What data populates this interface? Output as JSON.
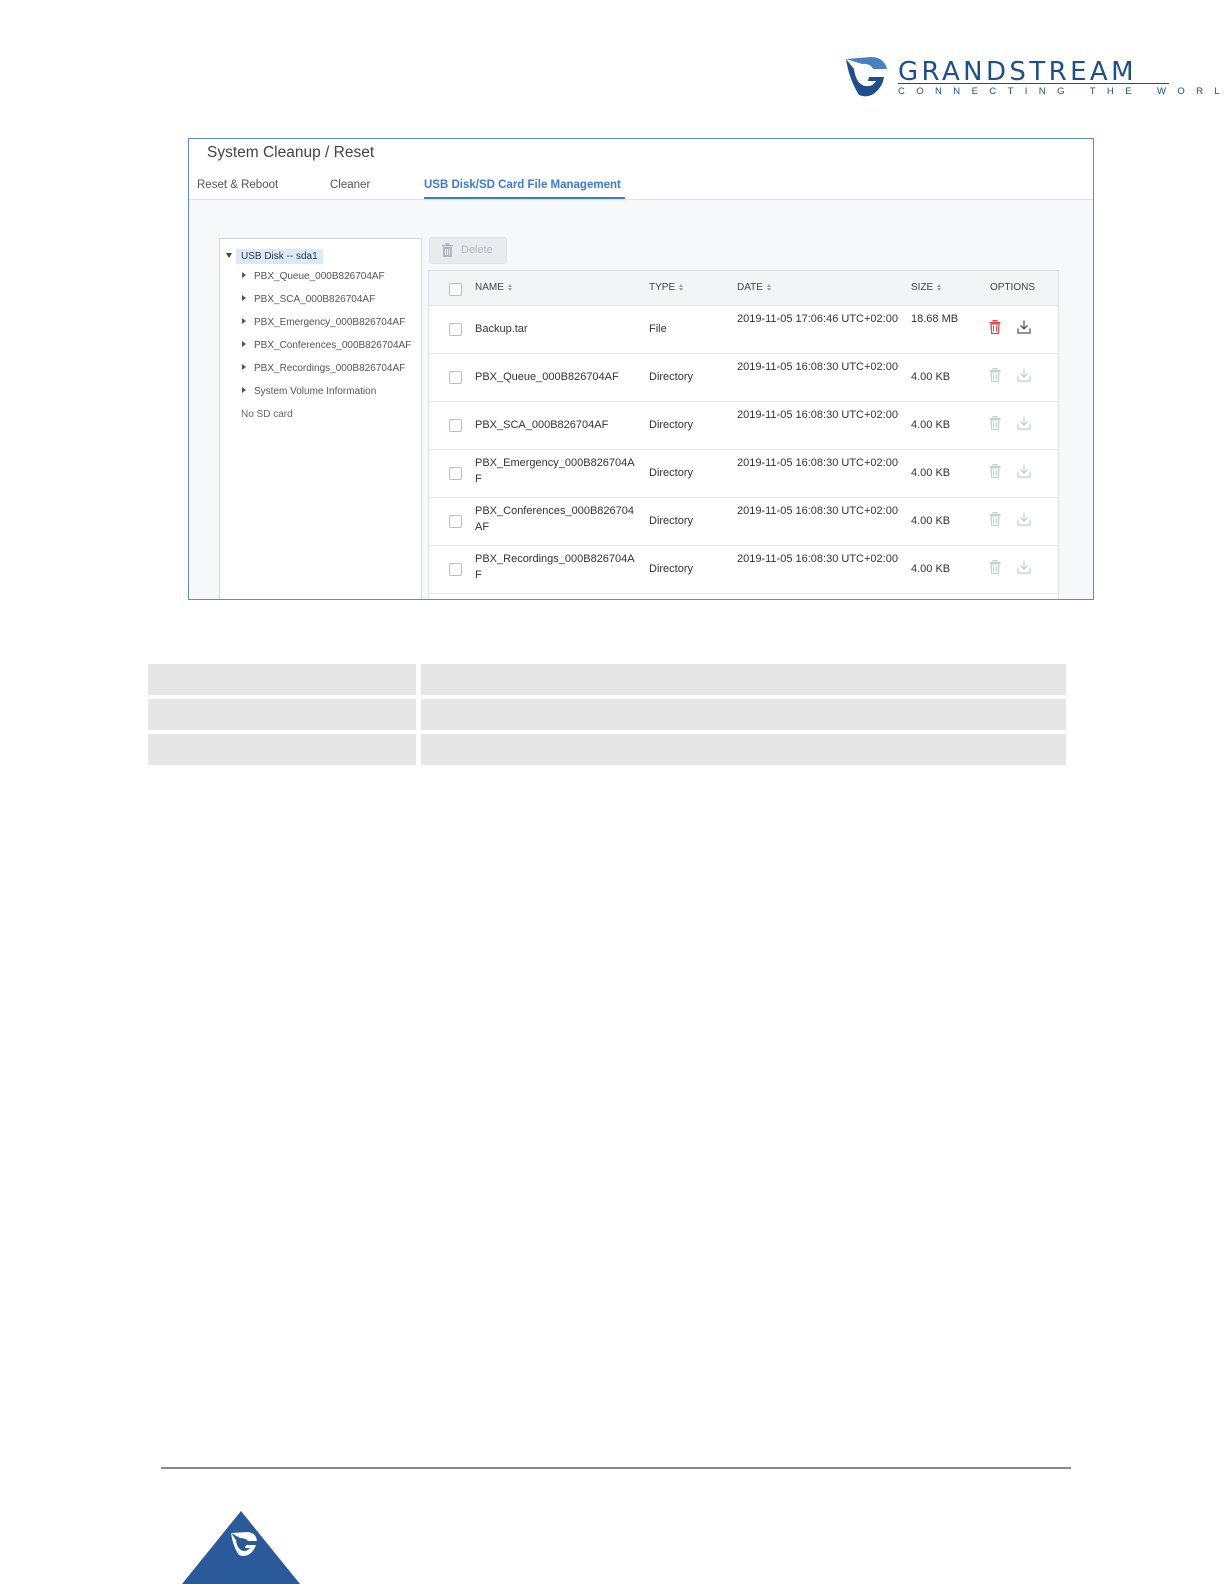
{
  "brand": {
    "name": "GRANDSTREAM",
    "tagline": "CONNECTING THE WORLD",
    "colors": {
      "primary": "#1f4e8c",
      "accent": "#3b7ad8",
      "delete_red": "#e24a4a"
    }
  },
  "panel": {
    "title": "System Cleanup / Reset",
    "tabs": [
      {
        "label": "Reset & Reboot",
        "active": false
      },
      {
        "label": "Cleaner",
        "active": false
      },
      {
        "label": "USB Disk/SD Card File Management",
        "active": true
      }
    ]
  },
  "tree": {
    "root": "USB Disk -- sda1",
    "items": [
      "PBX_Queue_000B826704AF",
      "PBX_SCA_000B826704AF",
      "PBX_Emergency_000B826704AF",
      "PBX_Conferences_000B826704AF",
      "PBX_Recordings_000B826704AF",
      "System Volume Information"
    ],
    "no_sd": "No SD card"
  },
  "toolbar": {
    "delete_label": "Delete",
    "delete_icon": "trash-icon"
  },
  "table": {
    "headers": {
      "name": "NAME",
      "type": "TYPE",
      "date": "DATE",
      "size": "SIZE",
      "options": "OPTIONS"
    },
    "rows": [
      {
        "name": "Backup.tar",
        "type": "File",
        "date": "2019-11-05 17:06:46 UTC+02:00",
        "size": "18.68 MB",
        "enabled": true
      },
      {
        "name": "PBX_Queue_000B826704AF",
        "type": "Directory",
        "date": "2019-11-05 16:08:30 UTC+02:00",
        "size": "4.00 KB",
        "enabled": false
      },
      {
        "name": "PBX_SCA_000B826704AF",
        "type": "Directory",
        "date": "2019-11-05 16:08:30 UTC+02:00",
        "size": "4.00 KB",
        "enabled": false
      },
      {
        "name": "PBX_Emergency_000B826704AF",
        "type": "Directory",
        "date": "2019-11-05 16:08:30 UTC+02:00",
        "size": "4.00 KB",
        "enabled": false
      },
      {
        "name": "PBX_Conferences_000B826704AF",
        "type": "Directory",
        "date": "2019-11-05 16:08:30 UTC+02:00",
        "size": "4.00 KB",
        "enabled": false
      },
      {
        "name": "PBX_Recordings_000B826704AF",
        "type": "Directory",
        "date": "2019-11-05 16:08:30 UTC+02:00",
        "size": "4.00 KB",
        "enabled": false
      }
    ]
  },
  "description_table": {
    "rows": 3
  }
}
